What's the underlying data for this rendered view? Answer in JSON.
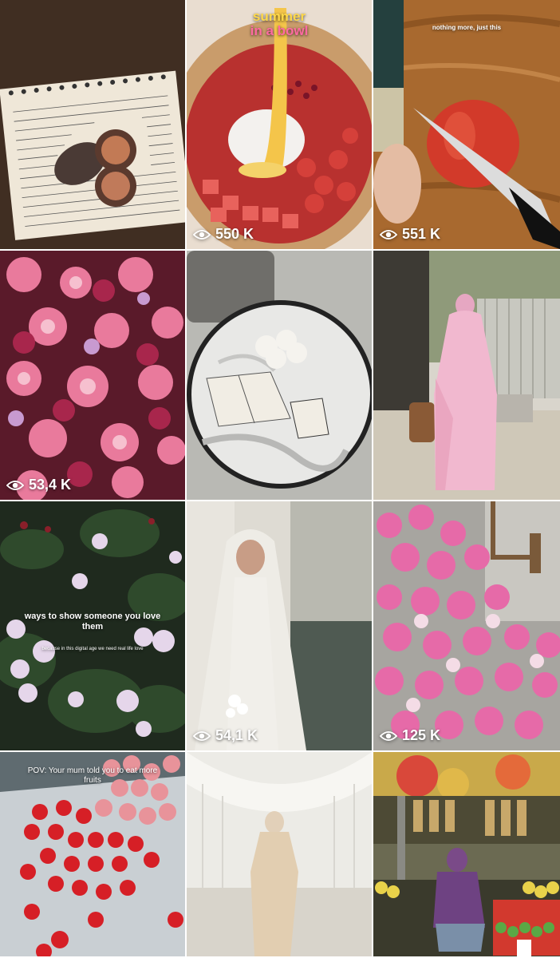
{
  "tiles": [
    {
      "name": "notebook-figs",
      "views": ""
    },
    {
      "name": "summer-bowl",
      "views": "550 K",
      "overlay_title_1": "summer",
      "overlay_title_2": "in a bowl"
    },
    {
      "name": "tomato-cutting",
      "views": "551 K",
      "overlay_caption": "nothing more, just this"
    },
    {
      "name": "pink-flowers",
      "views": "53,4 K"
    },
    {
      "name": "table-quran",
      "views": ""
    },
    {
      "name": "pink-dress",
      "views": ""
    },
    {
      "name": "roses-garden",
      "views": "",
      "overlay_heading": "ways to show someone you love them",
      "overlay_sub": "because in this digital age we need real life love"
    },
    {
      "name": "bride",
      "views": "54,1 K"
    },
    {
      "name": "bellflowers",
      "views": "125 K"
    },
    {
      "name": "strawberries",
      "views": "",
      "overlay_caption": "POV: Your mum told you to eat more fruits"
    },
    {
      "name": "bride-satin",
      "views": ""
    },
    {
      "name": "fruit-market",
      "views": ""
    }
  ],
  "icons": {
    "views": "eye-icon"
  },
  "colors": {
    "overlay_text": "#ffffff",
    "summer_title": "#ffd84a"
  }
}
